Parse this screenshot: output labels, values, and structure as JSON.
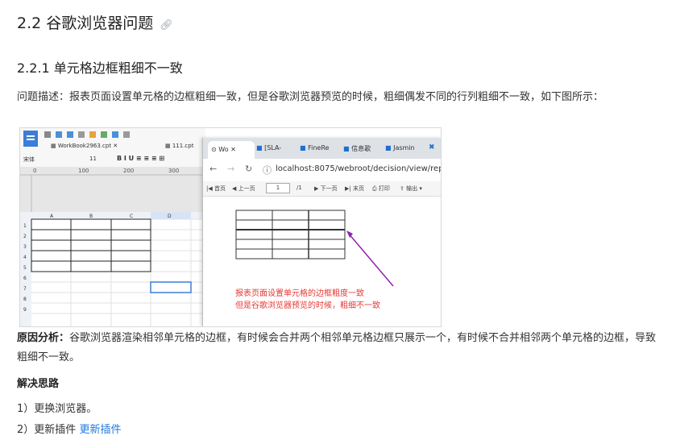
{
  "section": {
    "title": "2.2 谷歌浏览器问题",
    "link_icon": "link-icon"
  },
  "subsection": {
    "title": "2.2.1 单元格边框粗细不一致"
  },
  "problem": {
    "text": "问题描述：报表页面设置单元格的边框粗细一致，但是谷歌浏览器预览的时候，粗细偶发不同的行列粗细不一致，如下图所示："
  },
  "screenshot": {
    "designer": {
      "tab1": "WorkBook2963.cpt",
      "tab2": "111.cpt",
      "font_name": "宋体",
      "font_size": "11",
      "ruler_marks": [
        "0",
        "100",
        "200",
        "300"
      ],
      "col_headers": [
        "A",
        "B",
        "C",
        "D"
      ],
      "row_headers": [
        "1",
        "2",
        "3",
        "4",
        "5",
        "6",
        "7",
        "8",
        "9"
      ]
    },
    "browser": {
      "tabs": [
        "Wo",
        "[SLA-",
        "FineRe",
        "信息歌",
        "Jasmin"
      ],
      "url": "localhost:8075/webroot/decision/view/repo",
      "toolbar": [
        "首页",
        "上一页",
        "1",
        "/1",
        "下一页",
        "末页",
        "打印",
        "输出"
      ]
    },
    "annotation": {
      "line1": "报表页面设置单元格的边框粗度一致",
      "line2": "但是谷歌浏览器预览的时候，粗细不一致"
    }
  },
  "cause": {
    "label": "原因分析：",
    "text": "谷歌浏览器渲染相邻单元格的边框，有时候会合并两个相邻单元格边框只展示一个，有时候不合并相邻两个单元格的边框，导致粗细不一致。"
  },
  "solution": {
    "title": "解决思路",
    "item1": "1）更换浏览器。",
    "item2_prefix": "2）",
    "item2_text": "更新插件",
    "item2_link": "更新插件"
  }
}
